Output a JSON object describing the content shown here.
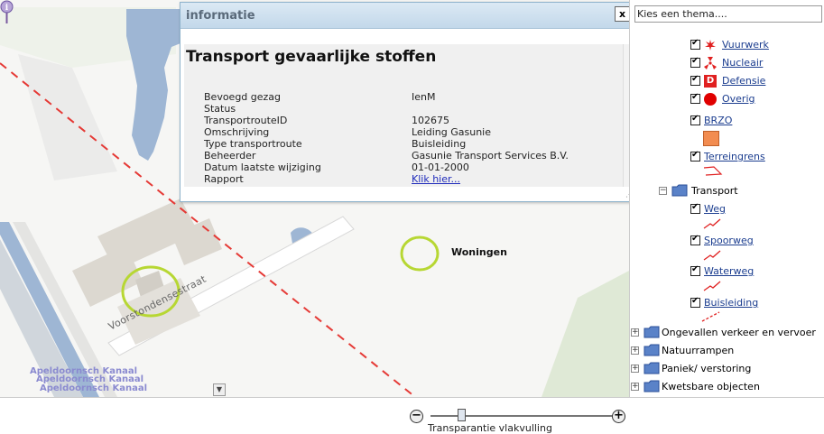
{
  "popup": {
    "title": "informatie",
    "close_label": "x",
    "heading": "Transport gevaarlijke stoffen",
    "properties": [
      {
        "key": "Bevoegd gezag",
        "value": "IenM"
      },
      {
        "key": "Status",
        "value": ""
      },
      {
        "key": "TransportrouteID",
        "value": "102675"
      },
      {
        "key": "Omschrijving",
        "value": "Leiding Gasunie"
      },
      {
        "key": "Type transportroute",
        "value": "Buisleiding"
      },
      {
        "key": "Beheerder",
        "value": "Gasunie Transport Services B.V."
      },
      {
        "key": "Datum laatste wijziging",
        "value": "01-01-2000"
      },
      {
        "key": "Rapport",
        "value": "Klik hier..."
      }
    ],
    "resize_glyph": "⋰"
  },
  "map": {
    "street_label": "Voorstondensestraat",
    "woningen_label": "Woningen",
    "canal_labels": [
      "Apeldoornsch Kanaal",
      "Apeldoornsch Kanaal",
      "Apeldoornsch Kanaal"
    ],
    "dropdown_glyph": "▼",
    "colors": {
      "water": "#9eb6d4",
      "building": "#dcd8d0",
      "park": "#d9e6d0",
      "green_circle": "#b7d733",
      "route_line": "#e53935"
    }
  },
  "panel": {
    "theme_select_placeholder": "Kies een thema....",
    "layers_top": [
      {
        "label": "Vuurwerk",
        "icon": "firework-icon"
      },
      {
        "label": "Nucleair",
        "icon": "nuclear-icon"
      },
      {
        "label": "Defensie",
        "icon": "defense-icon",
        "icon_text": "D"
      },
      {
        "label": "Overig",
        "icon": "other-icon"
      }
    ],
    "brzo_label": "BRZO",
    "terreingrens_label": "Terreingrens",
    "transport_folder": "Transport",
    "transport_layers": [
      "Weg",
      "Spoorweg",
      "Waterweg",
      "Buisleiding"
    ],
    "collapsed_folders": [
      "Ongevallen verkeer en vervoer",
      "Natuurrampen",
      "Paniek/ verstoring",
      "Kwetsbare objecten"
    ],
    "expander_minus": "−",
    "expander_plus": "+"
  },
  "bottom": {
    "zoom_out": "−",
    "zoom_in": "+",
    "slider_label": "Transparantie vlakvulling",
    "slider_value_fraction": 0.17
  }
}
